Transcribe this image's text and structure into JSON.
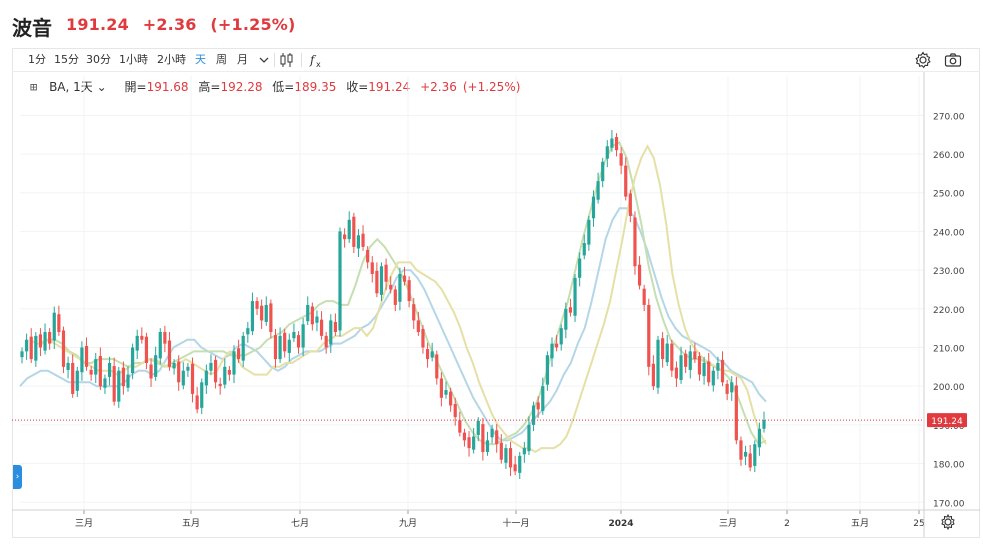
{
  "header": {
    "name": "波音",
    "price": "191.24",
    "change": "+2.36",
    "change_pct": "(+1.25%)"
  },
  "toolbar": {
    "intervals": [
      "1分",
      "15分",
      "30分",
      "1小時",
      "2小時",
      "天",
      "周",
      "月"
    ],
    "active_interval": "天",
    "dropdown_icon": "chevron-down-icon",
    "chart_type_icon": "candles-icon",
    "indicators_icon": "fx-icon",
    "settings_icon": "gear-icon",
    "snapshot_icon": "camera-icon"
  },
  "legend": {
    "symbol": "BA",
    "interval": "1天",
    "open_label": "開=",
    "open": "191.68",
    "high_label": "高=",
    "high": "192.28",
    "low_label": "低=",
    "low": "189.35",
    "close_label": "收=",
    "close": "191.24",
    "change": "+2.36",
    "change_pct": "(+1.25%)"
  },
  "colors": {
    "up": "#26a69a",
    "down": "#ef5350",
    "ma_fast": "#e5e0a6",
    "ma_mid": "#c5dfb0",
    "ma_slow": "#b4d6e6",
    "accent": "#2a8de0",
    "price_line": "#e0393e"
  },
  "chart_data": {
    "type": "candlestick",
    "symbol": "BA",
    "y_range": [
      168,
      275
    ],
    "y_ticks": [
      "170.00",
      "180.00",
      "190.00",
      "200.00",
      "210.00",
      "220.00",
      "230.00",
      "240.00",
      "250.00",
      "260.00",
      "270.00"
    ],
    "x_labels": [
      "三月",
      "五月",
      "七月",
      "九月",
      "十一月",
      "2024",
      "三月",
      "2",
      "五月",
      "25"
    ],
    "last_price_label": "191.24",
    "last_price": 191.24,
    "closes": [
      209,
      212,
      207,
      213,
      210,
      214,
      211,
      219,
      214,
      205,
      206,
      198,
      204,
      210,
      205,
      203,
      207,
      200,
      202,
      206,
      196,
      204,
      200,
      203,
      210,
      213,
      212,
      206,
      202,
      208,
      214,
      211,
      205,
      206,
      201,
      204,
      205,
      198,
      194,
      201,
      204,
      206,
      201,
      200,
      205,
      203,
      209,
      207,
      213,
      215,
      222,
      220,
      217,
      221,
      214,
      207,
      213,
      209,
      212,
      214,
      210,
      216,
      221,
      216,
      218,
      213,
      210,
      217,
      214,
      240,
      238,
      243,
      236,
      239,
      236,
      232,
      229,
      224,
      231,
      227,
      225,
      221,
      229,
      227,
      222,
      217,
      214,
      210,
      207,
      209,
      202,
      197,
      199,
      195,
      192,
      188,
      186,
      184,
      187,
      191,
      183,
      186,
      189,
      185,
      181,
      184,
      179,
      178,
      182,
      184,
      190,
      195,
      194,
      200,
      208,
      211,
      210,
      215,
      220,
      219,
      228,
      233,
      237,
      243,
      249,
      253,
      258,
      262,
      264,
      261,
      257,
      249,
      244,
      231,
      226,
      221,
      205,
      200,
      212,
      207,
      211,
      204,
      202,
      208,
      205,
      209,
      207,
      203,
      206,
      201,
      204,
      206,
      201,
      198,
      201,
      186,
      181,
      183,
      179,
      185,
      189,
      191.24
    ],
    "ma_fast": [
      212,
      211,
      211,
      212,
      211,
      210,
      209,
      208,
      207,
      206,
      205,
      204,
      204,
      204,
      203,
      204,
      205,
      205,
      206,
      207,
      207,
      206,
      205,
      205,
      206,
      207,
      206,
      205,
      204,
      203,
      204,
      207,
      209,
      208,
      205,
      204,
      203,
      203,
      203,
      205,
      205,
      206,
      206,
      207,
      208,
      209,
      209,
      211,
      212,
      213,
      213,
      214,
      215,
      215,
      213,
      215,
      220,
      225,
      229,
      232,
      232,
      232,
      230,
      229,
      228,
      227,
      225,
      222,
      219,
      215,
      210,
      206,
      201,
      197,
      193,
      190,
      188,
      186,
      185,
      184,
      184,
      183,
      184,
      184,
      184,
      185,
      187,
      191,
      196,
      201,
      206,
      211,
      216,
      222,
      230,
      238,
      247,
      254,
      259,
      262,
      259,
      252,
      242,
      229,
      221,
      215,
      211,
      209,
      207,
      206,
      205,
      204,
      204,
      203,
      202,
      199,
      193,
      188,
      185
    ],
    "ma_slow": [
      200,
      202,
      203,
      204,
      204,
      203,
      202,
      201,
      201,
      201,
      201,
      200,
      200,
      200,
      200,
      201,
      203,
      204,
      204,
      203,
      204,
      207,
      210,
      211,
      212,
      212,
      210,
      209,
      208,
      207,
      208,
      210,
      211,
      210,
      209,
      207,
      205,
      204,
      205,
      207,
      208,
      209,
      209,
      209,
      210,
      211,
      211,
      212,
      213,
      215,
      216,
      218,
      221,
      224,
      228,
      230,
      230,
      228,
      225,
      221,
      217,
      213,
      209,
      205,
      201,
      197,
      194,
      191,
      188,
      186,
      186,
      187,
      188,
      190,
      192,
      194,
      196,
      199,
      203,
      206,
      211,
      215,
      222,
      230,
      238,
      243,
      246,
      246,
      244,
      240,
      235,
      229,
      223,
      218,
      215,
      213,
      212,
      211,
      210,
      209,
      207,
      206,
      204,
      203,
      202,
      201,
      198,
      196
    ],
    "ma_mid": [
      211,
      212,
      212,
      211,
      209,
      208,
      206,
      206,
      207,
      207,
      207,
      206,
      205,
      206,
      206,
      207,
      206,
      205,
      206,
      207,
      208,
      209,
      209,
      209,
      209,
      209,
      208,
      208,
      208,
      209,
      210,
      212,
      213,
      214,
      216,
      217,
      218,
      219,
      221,
      222,
      222,
      221,
      221,
      226,
      232,
      236,
      238,
      236,
      233,
      230,
      226,
      221,
      216,
      211,
      207,
      203,
      199,
      195,
      191,
      188,
      186,
      185,
      185,
      186,
      187,
      188,
      190,
      193,
      197,
      203,
      210,
      216,
      222,
      230,
      238,
      245,
      252,
      258,
      262,
      263,
      259,
      251,
      242,
      231,
      223,
      217,
      212,
      210,
      208,
      207,
      207,
      206,
      205,
      204,
      202,
      198,
      193,
      188,
      185,
      186
    ]
  }
}
